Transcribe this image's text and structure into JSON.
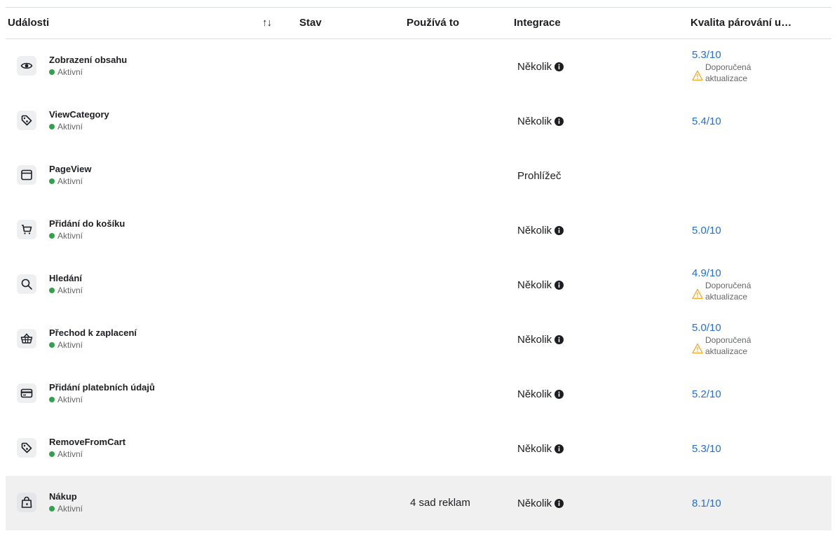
{
  "header": {
    "events": "Události",
    "sort": "↑↓",
    "status": "Stav",
    "used_by": "Používá to",
    "integration": "Integrace",
    "match_quality": "Kvalita párování u…"
  },
  "rows": [
    {
      "icon": "eye-icon",
      "name": "Zobrazení obsahu",
      "status": "Aktivní",
      "used_by": "",
      "integration": "Několik",
      "integration_info": true,
      "score": "5.3/10",
      "warning": "Doporučená aktualizace"
    },
    {
      "icon": "tag-icon",
      "name": "ViewCategory",
      "status": "Aktivní",
      "used_by": "",
      "integration": "Několik",
      "integration_info": true,
      "score": "5.4/10",
      "warning": ""
    },
    {
      "icon": "browser-window-icon",
      "name": "PageView",
      "status": "Aktivní",
      "used_by": "",
      "integration": "Prohlížeč",
      "integration_info": false,
      "score": "",
      "warning": ""
    },
    {
      "icon": "shopping-cart-icon",
      "name": "Přidání do košíku",
      "status": "Aktivní",
      "used_by": "",
      "integration": "Několik",
      "integration_info": true,
      "score": "5.0/10",
      "warning": ""
    },
    {
      "icon": "search-icon",
      "name": "Hledání",
      "status": "Aktivní",
      "used_by": "",
      "integration": "Několik",
      "integration_info": true,
      "score": "4.9/10",
      "warning": "Doporučená aktualizace"
    },
    {
      "icon": "basket-icon",
      "name": "Přechod k zaplacení",
      "status": "Aktivní",
      "used_by": "",
      "integration": "Několik",
      "integration_info": true,
      "score": "5.0/10",
      "warning": "Doporučená aktualizace"
    },
    {
      "icon": "credit-card-icon",
      "name": "Přidání platebních údajů",
      "status": "Aktivní",
      "used_by": "",
      "integration": "Několik",
      "integration_info": true,
      "score": "5.2/10",
      "warning": ""
    },
    {
      "icon": "tag-icon",
      "name": "RemoveFromCart",
      "status": "Aktivní",
      "used_by": "",
      "integration": "Několik",
      "integration_info": true,
      "score": "5.3/10",
      "warning": ""
    },
    {
      "icon": "shopping-bag-icon",
      "name": "Nákup",
      "status": "Aktivní",
      "used_by": "4 sad reklam",
      "integration": "Několik",
      "integration_info": true,
      "score": "8.1/10",
      "warning": "",
      "highlighted": true
    }
  ],
  "colors": {
    "active_dot": "#31a24c",
    "score_link": "#216fdb",
    "warning": "#f5a623",
    "highlight_row": "#f0f0f0"
  }
}
